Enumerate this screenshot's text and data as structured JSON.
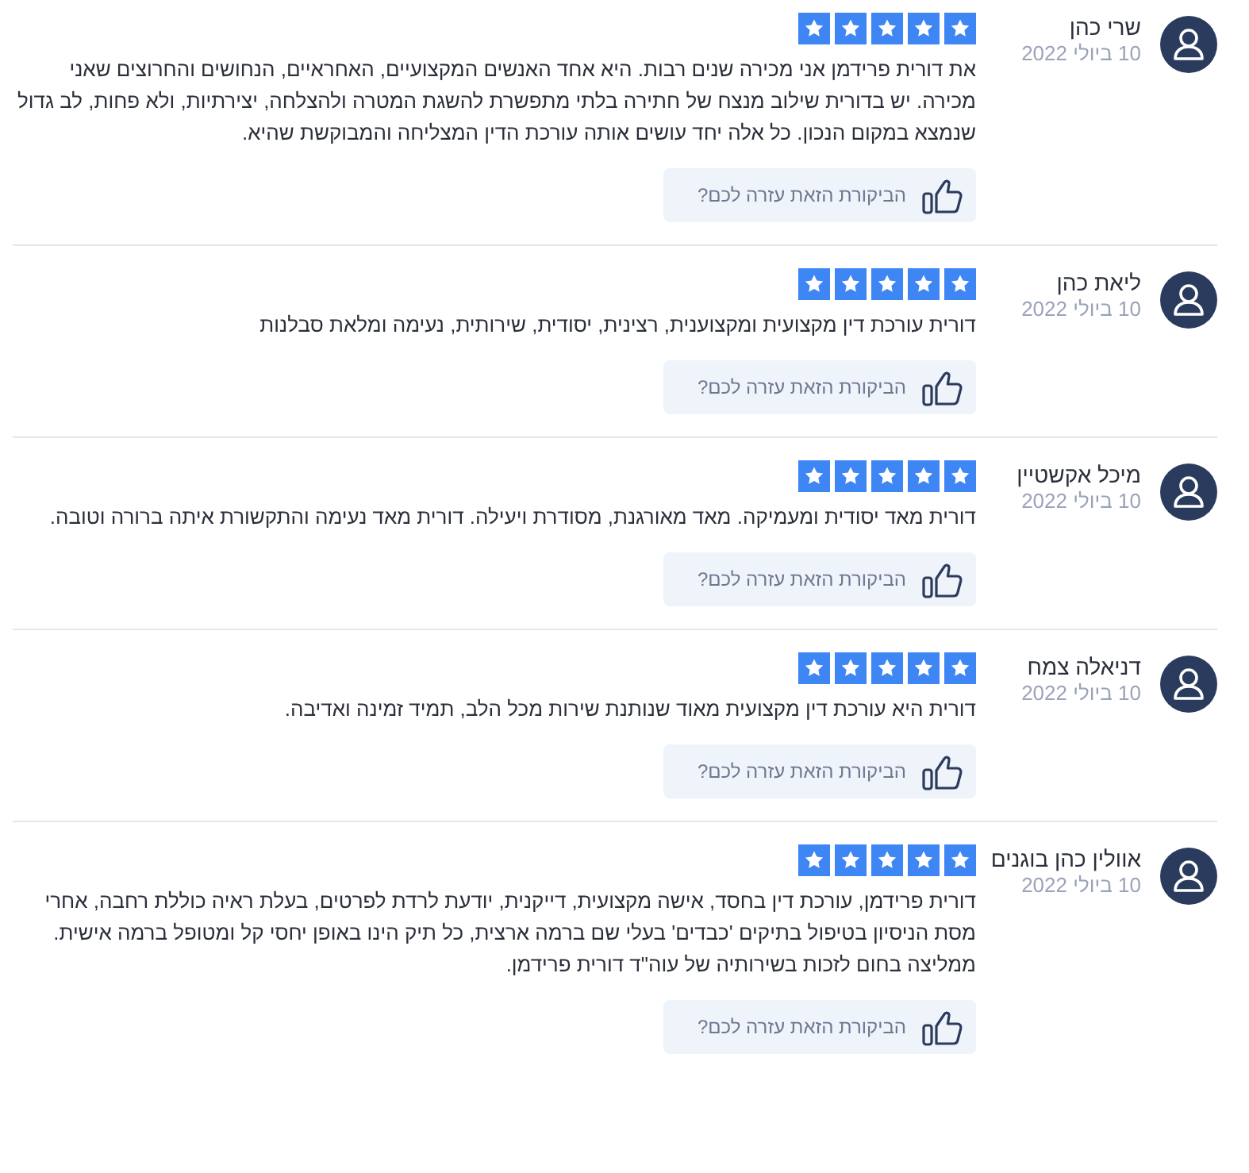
{
  "reviews": [
    {
      "name": "שרי כהן",
      "date": "10 ביולי 2022",
      "stars": 5,
      "text": "את דורית פרידמן אני מכירה שנים רבות. היא אחד האנשים המקצועיים, האחראיים, הנחושים והחרוצים שאני מכירה. יש בדורית שילוב מנצח של חתירה בלתי מתפשרת להשגת המטרה ולהצלחה, יצירתיות, ולא פחות, לב גדול שנמצא במקום הנכון. כל אלה יחד עושים אותה עורכת הדין המצליחה והמבוקשת שהיא.",
      "helpful": "הביקורת הזאת עזרה לכם?"
    },
    {
      "name": "ליאת כהן",
      "date": "10 ביולי 2022",
      "stars": 5,
      "text": "דורית עורכת דין מקצועית ומקצוענית, רצינית, יסודית, שירותית, נעימה ומלאת סבלנות",
      "helpful": "הביקורת הזאת עזרה לכם?"
    },
    {
      "name": "מיכל אקשטיין",
      "date": "10 ביולי 2022",
      "stars": 5,
      "text": "דורית מאד יסודית ומעמיקה. מאד מאורגנת, מסודרת ויעילה. דורית מאד נעימה והתקשורת איתה ברורה וטובה.",
      "helpful": "הביקורת הזאת עזרה לכם?"
    },
    {
      "name": "דניאלה צמח",
      "date": "10 ביולי 2022",
      "stars": 5,
      "text": "דורית היא עורכת דין מקצועית מאוד שנותנת שירות מכל הלב, תמיד זמינה ואדיבה.",
      "helpful": "הביקורת הזאת עזרה לכם?"
    },
    {
      "name": "אוולין כהן בוגנים",
      "date": "10 ביולי 2022",
      "stars": 5,
      "text": "דורית פרידמן, עורכת דין בחסד, אישה מקצועית, דייקנית, יודעת לרדת לפרטים, בעלת ראיה כוללת רחבה, אחרי מסת הניסיון בטיפול בתיקים 'כבדים' בעלי שם ברמה ארצית, כל תיק הינו באופן יחסי קל ומטופל ברמה אישית. ממליצה בחום לזכות בשירותיה של עוה\"ד דורית פרידמן.",
      "helpful": "הביקורת הזאת עזרה לכם?"
    }
  ]
}
